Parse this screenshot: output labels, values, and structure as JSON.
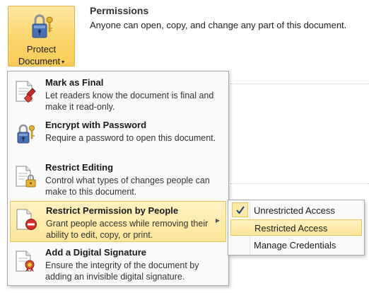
{
  "protect_button": {
    "line1": "Protect",
    "line2": "Document",
    "caret": "▾",
    "icon": "lock-keys-icon"
  },
  "permissions": {
    "title": "Permissions",
    "description": "Anyone can open, copy, and change any part of this document."
  },
  "menu": {
    "items": [
      {
        "title": "Mark as Final",
        "desc": "Let readers know the document is final and make it read-only.",
        "icon": "mark-final-icon"
      },
      {
        "title": "Encrypt with Password",
        "desc": "Require a password to open this document.",
        "icon": "encrypt-password-icon"
      },
      {
        "title": "Restrict Editing",
        "desc": "Control what types of changes people can make to this document.",
        "icon": "restrict-editing-icon"
      },
      {
        "title": "Restrict Permission by People",
        "desc": "Grant people access while removing their ability to edit, copy, or print.",
        "icon": "restrict-permission-icon",
        "submenu_arrow": "▶"
      },
      {
        "title": "Add a Digital Signature",
        "desc": "Ensure the integrity of the document by adding an invisible digital signature.",
        "icon": "digital-signature-icon"
      }
    ]
  },
  "submenu": {
    "items": [
      {
        "label": "Unrestricted Access",
        "checked": true
      },
      {
        "label": "Restricted Access",
        "highlighted": true
      },
      {
        "label": "Manage Credentials"
      }
    ]
  },
  "colors": {
    "highlight": "#fde69a",
    "highlight_border": "#e6c35c",
    "no_entry_red": "#d4302a"
  }
}
